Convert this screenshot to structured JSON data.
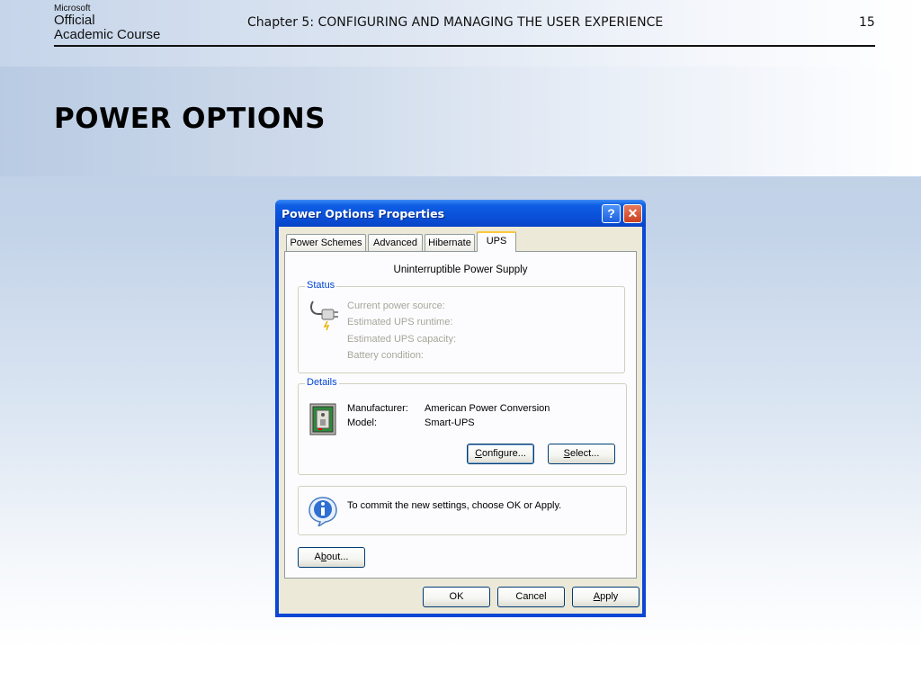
{
  "header": {
    "logo": {
      "brand": "Microsoft",
      "line1": "Official",
      "line2": "Academic Course"
    },
    "chapter": "Chapter 5: CONFIGURING AND MANAGING THE USER EXPERIENCE",
    "page_number": "15"
  },
  "slide": {
    "title": "POWER OPTIONS"
  },
  "dialog": {
    "title": "Power Options Properties",
    "help_glyph": "?",
    "close_glyph": "✕",
    "tabs": [
      {
        "label": "Power Schemes"
      },
      {
        "label": "Advanced"
      },
      {
        "label": "Hibernate"
      },
      {
        "label": "UPS",
        "active": true
      }
    ],
    "ups": {
      "heading": "Uninterruptible Power Supply",
      "status": {
        "label": "Status",
        "icon": "power-plug-icon",
        "rows": [
          "Current power source:",
          "Estimated UPS runtime:",
          "Estimated UPS capacity:",
          "Battery condition:"
        ]
      },
      "details": {
        "label": "Details",
        "icon": "ups-device-icon",
        "manufacturer_label": "Manufacturer:",
        "manufacturer_value": "American Power Conversion",
        "model_label": "Model:",
        "model_value": "Smart-UPS",
        "configure_button": {
          "pre": "",
          "key": "C",
          "post": "onfigure..."
        },
        "select_button": {
          "pre": "",
          "key": "S",
          "post": "elect..."
        }
      },
      "info": {
        "icon": "info-icon",
        "text": "To commit the new settings, choose OK or Apply."
      },
      "about_button": {
        "pre": "A",
        "key": "b",
        "post": "out..."
      }
    },
    "buttons": {
      "ok": "OK",
      "cancel": "Cancel",
      "apply": {
        "pre": "",
        "key": "A",
        "post": "pply"
      }
    }
  },
  "colors": {
    "titlebar": "#0a52dc",
    "dialog_face": "#ece9d8",
    "group_label": "#0046d5",
    "active_tab_accent": "#ffc83c",
    "disabled_text": "#a7a69b"
  }
}
